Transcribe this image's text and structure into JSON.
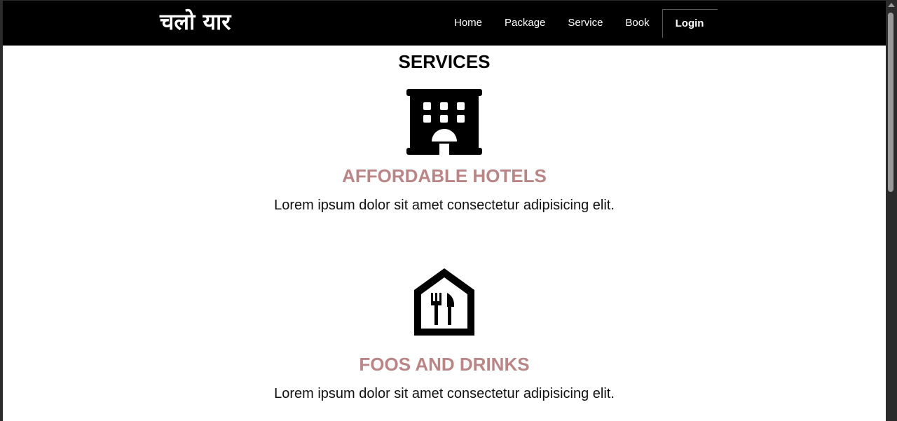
{
  "brand": {
    "name": "चलो यार"
  },
  "nav": {
    "items": [
      {
        "label": "Home"
      },
      {
        "label": "Package"
      },
      {
        "label": "Service"
      },
      {
        "label": "Book"
      }
    ],
    "login_label": "Login"
  },
  "services": {
    "title": "SERVICES",
    "items": [
      {
        "icon": "hotel-icon",
        "heading": "AFFORDABLE HOTELS",
        "text": "Lorem ipsum dolor sit amet consectetur adipisicing elit."
      },
      {
        "icon": "restaurant-icon",
        "heading": "FOOS AND DRINKS",
        "text": "Lorem ipsum dolor sit amet consectetur adipisicing elit."
      }
    ]
  },
  "colors": {
    "navbar_bg": "#000000",
    "accent_heading": "#bc8585",
    "page_bg": "#ffffff"
  }
}
